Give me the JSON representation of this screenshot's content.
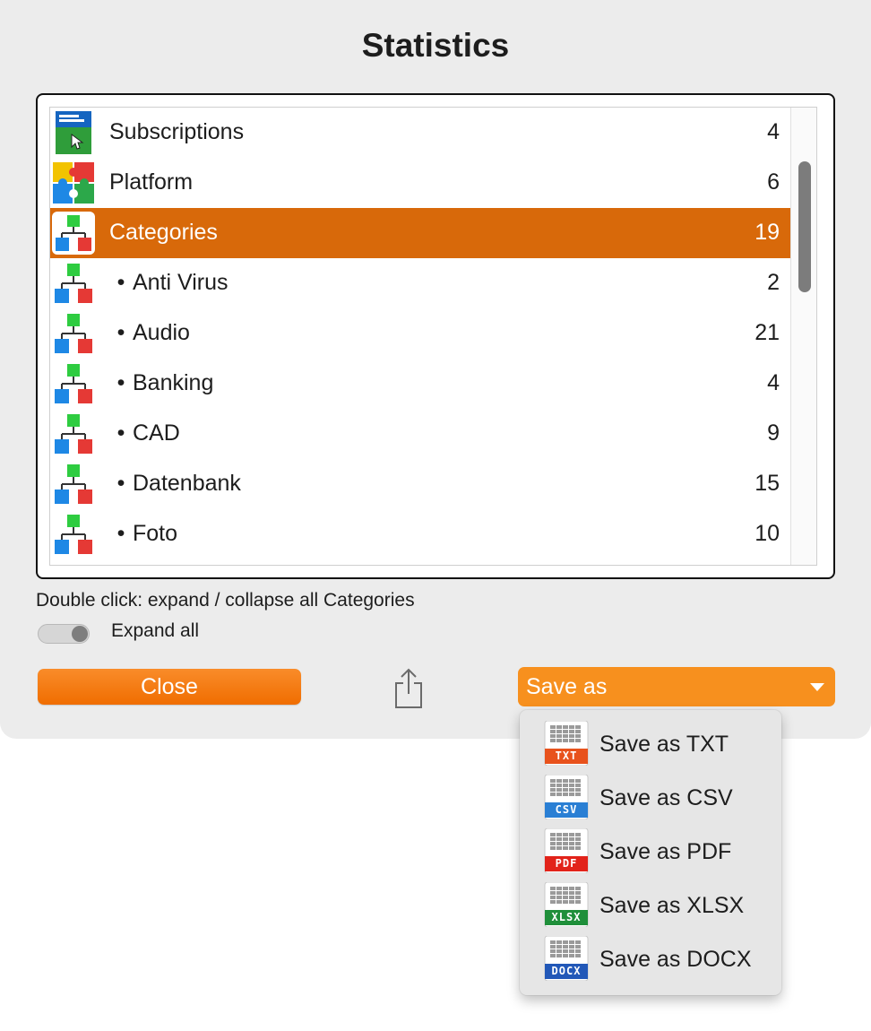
{
  "dialog": {
    "title": "Statistics",
    "hint": "Double click: expand / collapse all Categories",
    "toggle": {
      "label": "Expand all",
      "on": true
    },
    "close_label": "Close",
    "save_as_label": "Save as"
  },
  "list": {
    "selected_index": 2,
    "rows": [
      {
        "label": "Subscriptions",
        "count": "4",
        "icon": "license-manager-icon",
        "child": false
      },
      {
        "label": "Platform",
        "count": "6",
        "icon": "puzzle-icon",
        "child": false
      },
      {
        "label": "Categories",
        "count": "19",
        "icon": "category-tree-icon",
        "child": false
      },
      {
        "label": "Anti Virus",
        "count": "2",
        "icon": "category-tree-icon",
        "child": true
      },
      {
        "label": "Audio",
        "count": "21",
        "icon": "category-tree-icon",
        "child": true
      },
      {
        "label": "Banking",
        "count": "4",
        "icon": "category-tree-icon",
        "child": true
      },
      {
        "label": "CAD",
        "count": "9",
        "icon": "category-tree-icon",
        "child": true
      },
      {
        "label": "Datenbank",
        "count": "15",
        "icon": "category-tree-icon",
        "child": true
      },
      {
        "label": "Foto",
        "count": "10",
        "icon": "category-tree-icon",
        "child": true
      }
    ],
    "bullet": "•"
  },
  "menu": {
    "items": [
      {
        "label": "Save as TXT",
        "badge": "TXT",
        "color": "#e8521c"
      },
      {
        "label": "Save as CSV",
        "badge": "CSV",
        "color": "#2a7fd4"
      },
      {
        "label": "Save as PDF",
        "badge": "PDF",
        "color": "#e2231a"
      },
      {
        "label": "Save as XLSX",
        "badge": "XLSX",
        "color": "#1f8f3a"
      },
      {
        "label": "Save as DOCX",
        "badge": "DOCX",
        "color": "#2258b8"
      }
    ]
  },
  "colors": {
    "accent": "#d8690a",
    "button_orange": "#f7901e"
  }
}
